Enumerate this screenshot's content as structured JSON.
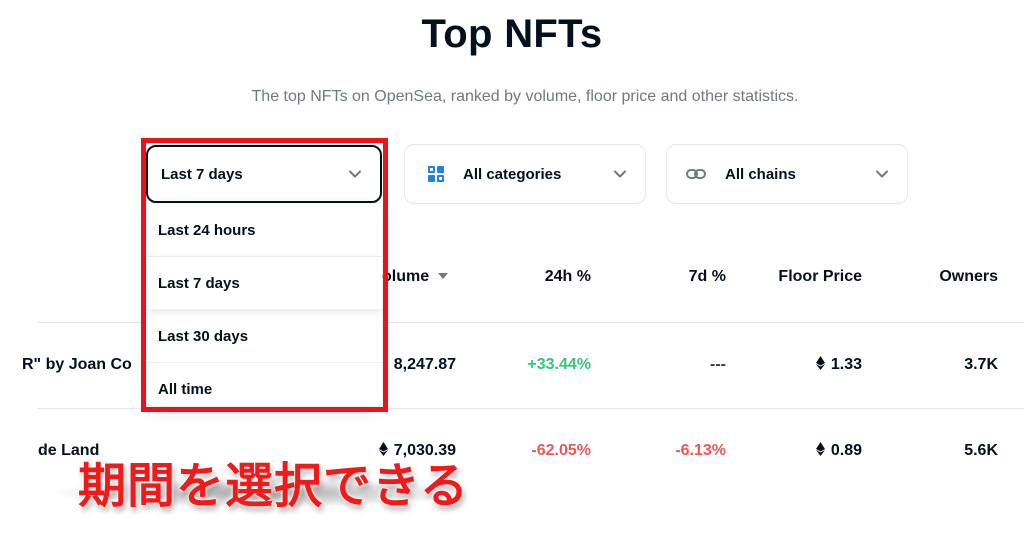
{
  "header": {
    "title": "Top NFTs",
    "subtitle": "The top NFTs on OpenSea, ranked by volume, floor price and other statistics."
  },
  "filters": {
    "time": {
      "label": "Last 7 days",
      "icon": "chevron-down-icon"
    },
    "category": {
      "label": "All categories",
      "icon": "grid-icon"
    },
    "chain": {
      "label": "All chains",
      "icon": "link-icon"
    }
  },
  "dropdown": {
    "options": [
      "Last 24 hours",
      "Last 7 days",
      "Last 30 days",
      "All time"
    ],
    "selected": "Last 7 days"
  },
  "table": {
    "headers": {
      "volume": "olume",
      "change_24h": "24h %",
      "change_7d": "7d %",
      "floor": "Floor Price",
      "owners": "Owners"
    },
    "rows": [
      {
        "name": "R\" by Joan Co",
        "volume": "8,247.87",
        "change_24h": "+33.44%",
        "change_7d": "---",
        "floor": "1.33",
        "owners": "3.7K"
      },
      {
        "name": "de Land",
        "volume": "7,030.39",
        "change_24h": "-62.05%",
        "change_7d": "-6.13%",
        "floor": "0.89",
        "owners": "5.6K"
      }
    ]
  },
  "annotation": {
    "text": "期間を選択できる",
    "color": "#f01a1a"
  },
  "colors": {
    "positive": "#34c77b",
    "negative": "#eb5757",
    "highlight": "#e8141c"
  }
}
